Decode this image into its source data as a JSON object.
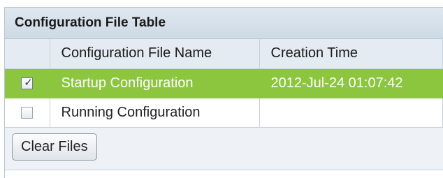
{
  "panel": {
    "title": "Configuration File Table"
  },
  "table": {
    "columns": [
      "",
      "Configuration File Name",
      "Creation Time"
    ],
    "rows": [
      {
        "checked": true,
        "name": "Startup Configuration",
        "creation_time": "2012-Jul-24 01:07:42"
      },
      {
        "checked": false,
        "name": "Running Configuration",
        "creation_time": ""
      }
    ]
  },
  "footer": {
    "clear_button_label": "Clear Files"
  },
  "colors": {
    "selected_row": "#8cc63f",
    "title_bar": "#cdd9e4"
  }
}
